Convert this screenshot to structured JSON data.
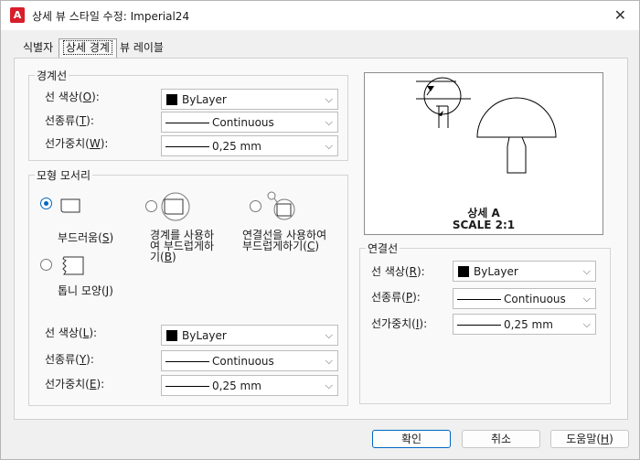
{
  "window": {
    "app_icon_letter": "A",
    "title": "상세 뷰 스타일 수정: Imperial24"
  },
  "tabs": [
    {
      "label": "식별자",
      "active": false
    },
    {
      "label": "상세 경계",
      "active": true
    },
    {
      "label": "뷰 레이블",
      "active": false
    }
  ],
  "boundary_lines": {
    "title": "경계선",
    "color_label": "선 색상(",
    "color_key": "O",
    "color_value": "ByLayer",
    "linetype_label": "선종류(",
    "linetype_key": "T",
    "linetype_value": "Continuous",
    "lineweight_label": "선가중치(",
    "lineweight_key": "W",
    "lineweight_value": "0,25 mm"
  },
  "model_edge": {
    "title": "모형 모서리",
    "options": [
      {
        "label": "부드러움(",
        "key": "S",
        "checked": true
      },
      {
        "label_line1": "경계를 사용하",
        "label_line2": "여 부드럽게하",
        "label_line3": "기(",
        "key": "B",
        "checked": false
      },
      {
        "label_line1": "연결선을 사용하여",
        "label_line2": "부드럽게하기(",
        "key": "C",
        "checked": false
      },
      {
        "label": "톱니 모양(",
        "key": "J",
        "checked": false
      }
    ],
    "color_label": "선 색상(",
    "color_key": "L",
    "color_value": "ByLayer",
    "linetype_label": "선종류(",
    "linetype_key": "Y",
    "linetype_value": "Continuous",
    "lineweight_label": "선가중치(",
    "lineweight_key": "E",
    "lineweight_value": "0,25 mm"
  },
  "preview": {
    "caption_line1": "상세 A",
    "caption_line2": "SCALE 2:1"
  },
  "connection_line": {
    "title": "연결선",
    "color_label": "선 색상(",
    "color_key": "R",
    "color_value": "ByLayer",
    "linetype_label": "선종류(",
    "linetype_key": "P",
    "linetype_value": "Continuous",
    "lineweight_label": "선가중치(",
    "lineweight_key": "I",
    "lineweight_value": "0,25 mm"
  },
  "buttons": {
    "ok": "확인",
    "cancel": "취소",
    "help": "도움말(",
    "help_key": "H"
  },
  "close_glyph": "✕",
  "chevron_glyph": "⌵"
}
